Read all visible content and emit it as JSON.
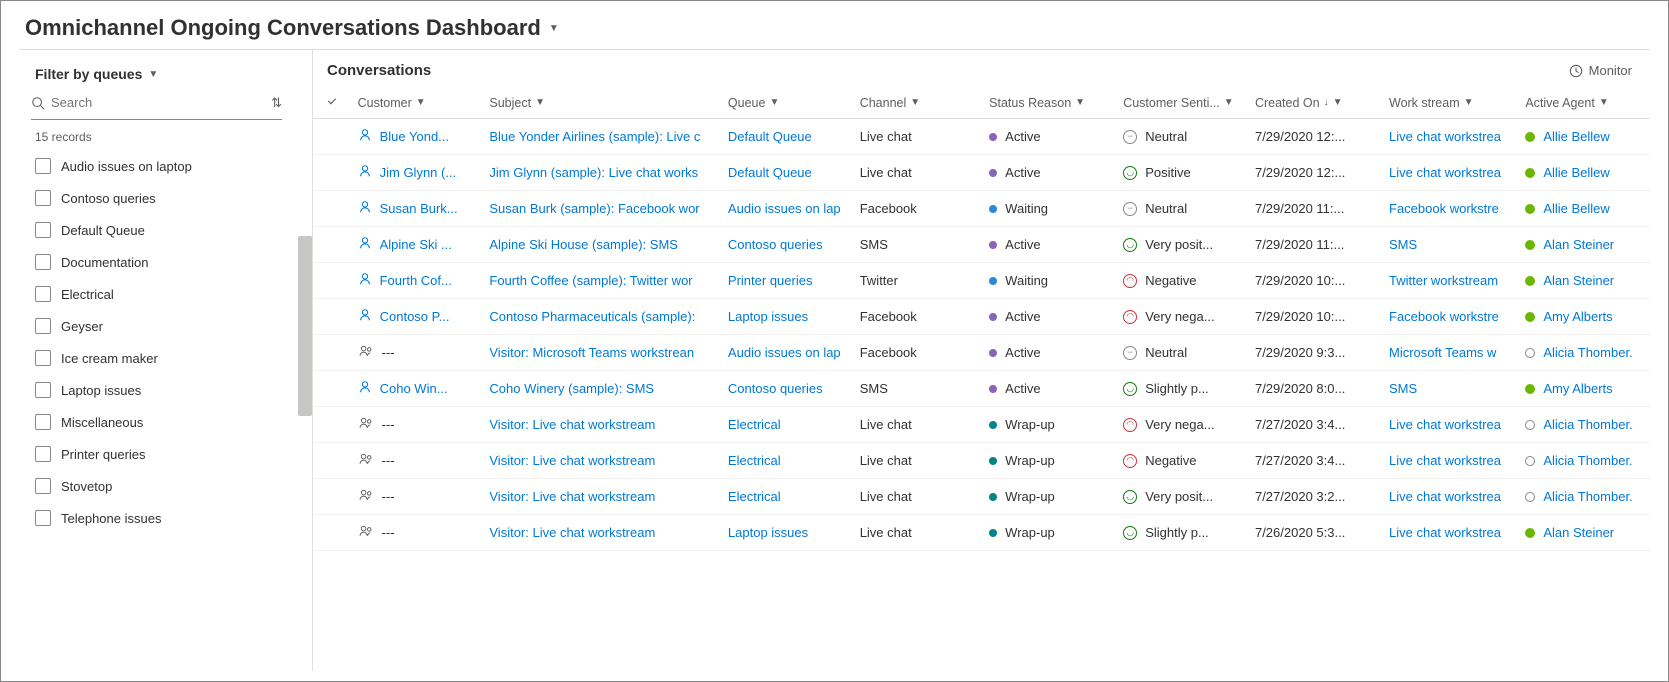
{
  "header": {
    "title": "Omnichannel Ongoing Conversations Dashboard"
  },
  "sidebar": {
    "filter_title": "Filter by queues",
    "search_placeholder": "Search",
    "records_label": "15 records",
    "queues": [
      "Audio issues on laptop",
      "Contoso queries",
      "Default Queue",
      "Documentation",
      "Electrical",
      "Geyser",
      "Ice cream maker",
      "Laptop issues",
      "Miscellaneous",
      "Printer queries",
      "Stovetop",
      "Telephone issues"
    ]
  },
  "main": {
    "title": "Conversations",
    "monitor_label": "Monitor",
    "columns": {
      "customer": "Customer",
      "subject": "Subject",
      "queue": "Queue",
      "channel": "Channel",
      "status": "Status Reason",
      "sentiment": "Customer Senti...",
      "created": "Created On",
      "work": "Work stream",
      "agent": "Active Agent"
    },
    "rows": [
      {
        "icon": "person",
        "customer": "Blue Yond...",
        "subject": "Blue Yonder Airlines (sample): Live c",
        "queue": "Default Queue",
        "channel": "Live chat",
        "status_dot": "purple",
        "status": "Active",
        "sent_face": "neutral",
        "sentiment": "Neutral",
        "created": "7/29/2020 12:...",
        "work": "Live chat workstrea",
        "agent_dot": "green",
        "agent": "Allie Bellew"
      },
      {
        "icon": "person",
        "customer": "Jim Glynn (...",
        "subject": "Jim Glynn (sample): Live chat works",
        "queue": "Default Queue",
        "channel": "Live chat",
        "status_dot": "purple",
        "status": "Active",
        "sent_face": "pos",
        "sentiment": "Positive",
        "created": "7/29/2020 12:...",
        "work": "Live chat workstrea",
        "agent_dot": "green",
        "agent": "Allie Bellew"
      },
      {
        "icon": "person",
        "customer": "Susan Burk...",
        "subject": "Susan Burk (sample): Facebook wor",
        "queue": "Audio issues on lap",
        "channel": "Facebook",
        "status_dot": "blue",
        "status": "Waiting",
        "sent_face": "neutral",
        "sentiment": "Neutral",
        "created": "7/29/2020 11:...",
        "work": "Facebook workstre",
        "agent_dot": "green",
        "agent": "Allie Bellew"
      },
      {
        "icon": "person",
        "customer": "Alpine Ski ...",
        "subject": "Alpine Ski House (sample): SMS",
        "queue": "Contoso queries",
        "channel": "SMS",
        "status_dot": "purple",
        "status": "Active",
        "sent_face": "pos",
        "sentiment": "Very posit...",
        "created": "7/29/2020 11:...",
        "work": "SMS",
        "agent_dot": "green",
        "agent": "Alan Steiner"
      },
      {
        "icon": "person",
        "customer": "Fourth Cof...",
        "subject": "Fourth Coffee (sample): Twitter wor",
        "queue": "Printer queries",
        "channel": "Twitter",
        "status_dot": "blue",
        "status": "Waiting",
        "sent_face": "neg",
        "sentiment": "Negative",
        "created": "7/29/2020 10:...",
        "work": "Twitter workstream",
        "agent_dot": "green",
        "agent": "Alan Steiner"
      },
      {
        "icon": "person",
        "customer": "Contoso P...",
        "subject": "Contoso Pharmaceuticals (sample):",
        "queue": "Laptop issues",
        "channel": "Facebook",
        "status_dot": "purple",
        "status": "Active",
        "sent_face": "neg",
        "sentiment": "Very nega...",
        "created": "7/29/2020 10:...",
        "work": "Facebook workstre",
        "agent_dot": "green",
        "agent": "Amy Alberts"
      },
      {
        "icon": "people",
        "customer": "---",
        "subject": "Visitor: Microsoft Teams workstrean",
        "queue": "Audio issues on lap",
        "channel": "Facebook",
        "status_dot": "purple",
        "status": "Active",
        "sent_face": "neutral",
        "sentiment": "Neutral",
        "created": "7/29/2020 9:3...",
        "work": "Microsoft Teams w",
        "agent_dot": "ring",
        "agent": "Alicia Thomber."
      },
      {
        "icon": "person",
        "customer": "Coho Win...",
        "subject": "Coho Winery (sample): SMS",
        "queue": "Contoso queries",
        "channel": "SMS",
        "status_dot": "purple",
        "status": "Active",
        "sent_face": "pos",
        "sentiment": "Slightly p...",
        "created": "7/29/2020 8:0...",
        "work": "SMS",
        "agent_dot": "green",
        "agent": "Amy Alberts"
      },
      {
        "icon": "people",
        "customer": "---",
        "subject": "Visitor: Live chat workstream",
        "queue": "Electrical",
        "channel": "Live chat",
        "status_dot": "teal",
        "status": "Wrap-up",
        "sent_face": "neg",
        "sentiment": "Very nega...",
        "created": "7/27/2020 3:4...",
        "work": "Live chat workstrea",
        "agent_dot": "ring",
        "agent": "Alicia Thomber."
      },
      {
        "icon": "people",
        "customer": "---",
        "subject": "Visitor: Live chat workstream",
        "queue": "Electrical",
        "channel": "Live chat",
        "status_dot": "teal",
        "status": "Wrap-up",
        "sent_face": "neg",
        "sentiment": "Negative",
        "created": "7/27/2020 3:4...",
        "work": "Live chat workstrea",
        "agent_dot": "ring",
        "agent": "Alicia Thomber."
      },
      {
        "icon": "people",
        "customer": "---",
        "subject": "Visitor: Live chat workstream",
        "queue": "Electrical",
        "channel": "Live chat",
        "status_dot": "teal",
        "status": "Wrap-up",
        "sent_face": "pos",
        "sentiment": "Very posit...",
        "created": "7/27/2020 3:2...",
        "work": "Live chat workstrea",
        "agent_dot": "ring",
        "agent": "Alicia Thomber."
      },
      {
        "icon": "people",
        "customer": "---",
        "subject": "Visitor: Live chat workstream",
        "queue": "Laptop issues",
        "channel": "Live chat",
        "status_dot": "teal",
        "status": "Wrap-up",
        "sent_face": "pos",
        "sentiment": "Slightly p...",
        "created": "7/26/2020 5:3...",
        "work": "Live chat workstrea",
        "agent_dot": "green",
        "agent": "Alan Steiner"
      }
    ]
  }
}
